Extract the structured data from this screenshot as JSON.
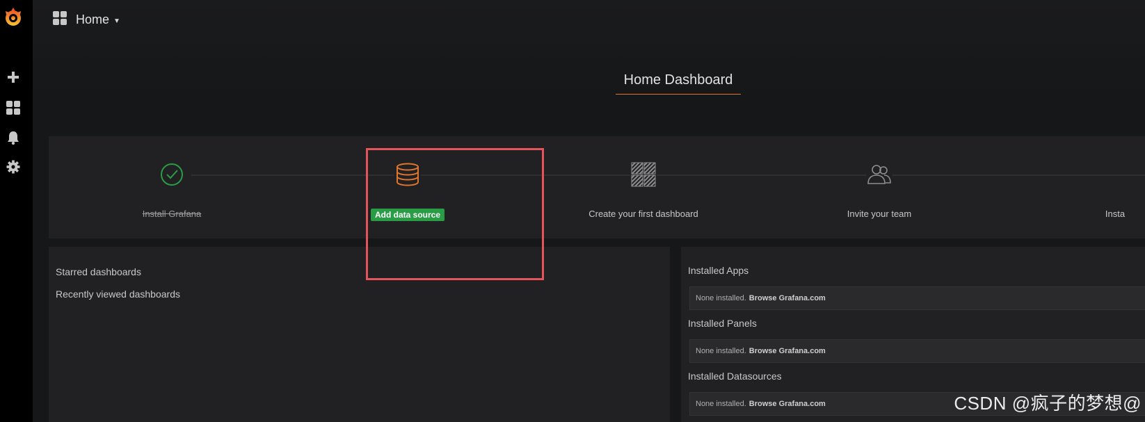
{
  "topbar": {
    "title": "Home"
  },
  "dashboard": {
    "title": "Home Dashboard"
  },
  "steps": [
    {
      "label": "Install Grafana",
      "state": "done"
    },
    {
      "label": "Add data source",
      "state": "active"
    },
    {
      "label": "Create your first dashboard",
      "state": "todo"
    },
    {
      "label": "Invite your team",
      "state": "todo"
    },
    {
      "label": "Insta",
      "state": "todo"
    }
  ],
  "left_panel": {
    "starred": "Starred dashboards",
    "recent": "Recently viewed dashboards"
  },
  "right_panel": {
    "sections": [
      {
        "title": "Installed Apps",
        "text": "None installed.",
        "link": "Browse Grafana.com"
      },
      {
        "title": "Installed Panels",
        "text": "None installed.",
        "link": "Browse Grafana.com"
      },
      {
        "title": "Installed Datasources",
        "text": "None installed.",
        "link": "Browse Grafana.com"
      }
    ]
  },
  "watermark": "CSDN @疯子的梦想@",
  "colors": {
    "accent": "#e0752d",
    "success": "#299c46",
    "highlight": "#e4545a"
  },
  "icons": [
    "grafana-logo-icon",
    "plus-icon",
    "dashboards-icon",
    "bell-icon",
    "gear-icon",
    "check-circle-icon",
    "database-icon",
    "dashboard-grid-icon",
    "users-icon"
  ]
}
